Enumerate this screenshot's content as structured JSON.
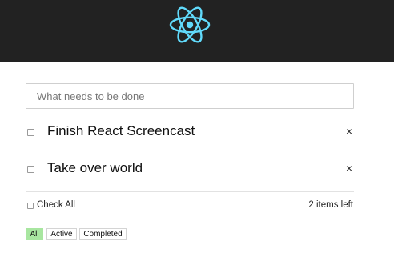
{
  "header": {
    "logo_icon": "react-logo-icon",
    "logo_color": "#61dafb",
    "background": "#222222"
  },
  "new_todo": {
    "placeholder": "What needs to be done",
    "value": ""
  },
  "todos": [
    {
      "text": "Finish React Screencast",
      "completed": false,
      "delete_icon": "×"
    },
    {
      "text": "Take over world",
      "completed": false,
      "delete_icon": "×"
    }
  ],
  "footer": {
    "check_all_label": "Check All",
    "items_left": "2 items left"
  },
  "filters": [
    {
      "label": "All",
      "selected": true
    },
    {
      "label": "Active",
      "selected": false
    },
    {
      "label": "Completed",
      "selected": false
    }
  ],
  "colors": {
    "selected_filter": "#a8e6a0"
  }
}
